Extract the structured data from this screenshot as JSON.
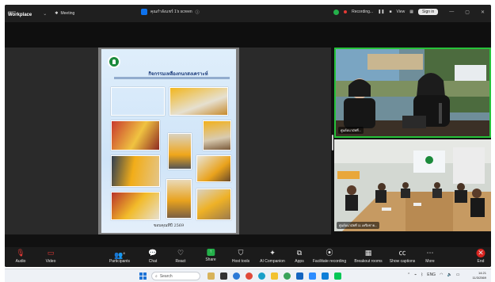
{
  "app": {
    "brand_top": "zoom",
    "brand_name": "Workplace",
    "meeting_label": "Meeting"
  },
  "share_tab": {
    "label": "คุณกำลังแชร์ 1's screen"
  },
  "titlebar_right": {
    "recording": "Recording...",
    "view": "View",
    "signin": "Sign in"
  },
  "poster": {
    "title": "กิจกรรมเหลืองกนกสงเคราะห์",
    "date": "ขอบคุณทีปี 2569"
  },
  "tiles": [
    {
      "name": "ศูนย์อนามัยที่..."
    },
    {
      "name": "ศูนย์อนามัยที่ 11 เครือข่าย..."
    }
  ],
  "toolbar": {
    "audio": "Audio",
    "video": "Video",
    "participants": "Participants",
    "participant_count": "8",
    "chat": "Chat",
    "react": "React",
    "share": "Share",
    "host_tools": "Host tools",
    "ai_companion": "AI Companion",
    "apps": "Apps",
    "facilitate": "Facilitate recording",
    "breakout": "Breakout rooms",
    "captions": "Show captions",
    "more": "More",
    "end": "End"
  },
  "taskbar": {
    "search_placeholder": "Search",
    "time": "14:21",
    "date": "11/3/2569",
    "lang": "ENG"
  },
  "colors": {
    "accent": "#0e72ed",
    "active_speaker": "#26c23a",
    "end": "#d8231f"
  }
}
